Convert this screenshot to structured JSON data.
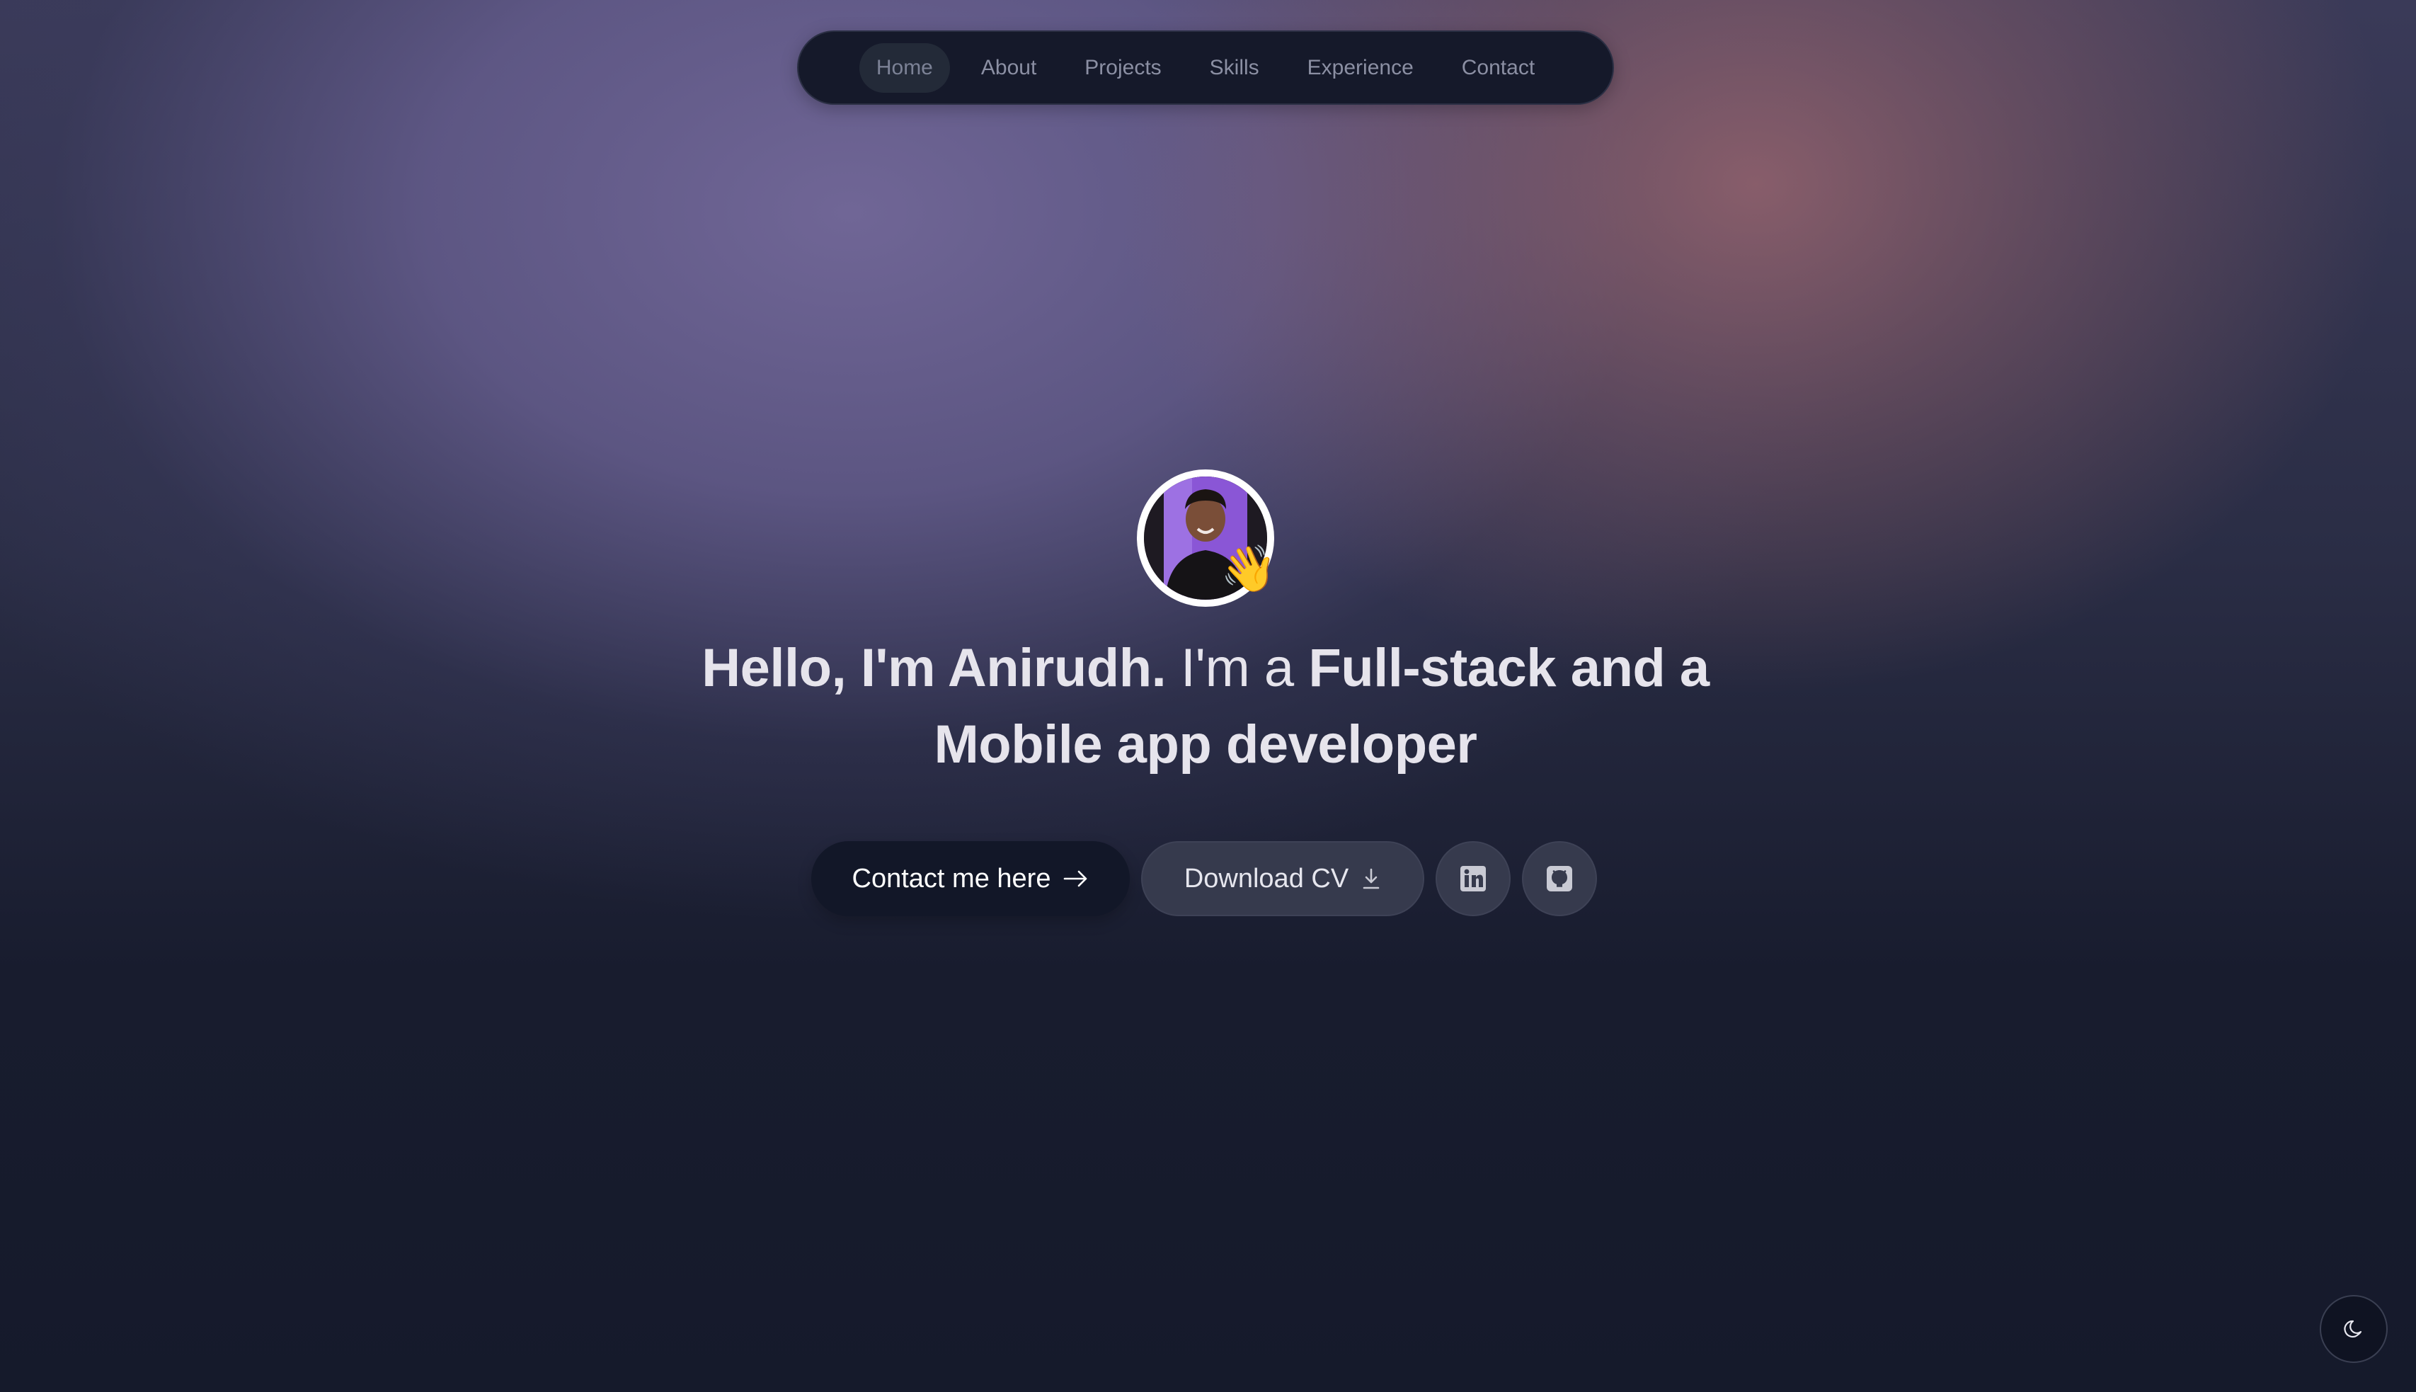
{
  "nav": {
    "items": [
      {
        "label": "Home",
        "active": true
      },
      {
        "label": "About"
      },
      {
        "label": "Projects"
      },
      {
        "label": "Skills"
      },
      {
        "label": "Experience"
      },
      {
        "label": "Contact"
      }
    ]
  },
  "hero": {
    "avatar_icon": "profile-photo",
    "wave_emoji": "👋",
    "headline_part1": "Hello, I'm Anirudh.",
    "headline_part2": " I'm a ",
    "headline_part3": "Full-stack and a Mobile app developer"
  },
  "actions": {
    "contact_label": "Contact me here",
    "contact_icon": "arrow-right-icon",
    "cv_label": "Download CV",
    "cv_icon": "download-icon",
    "linkedin_icon": "linkedin-icon",
    "github_icon": "github-icon"
  },
  "theme_toggle": {
    "icon": "moon-icon"
  },
  "colors": {
    "background": "#161b2c",
    "accent_purple": "#7066a0",
    "accent_rose": "#96646e",
    "nav_bg": "#15192a",
    "contact_bg": "#121728",
    "secondary_btn_bg": "#363a4d"
  }
}
